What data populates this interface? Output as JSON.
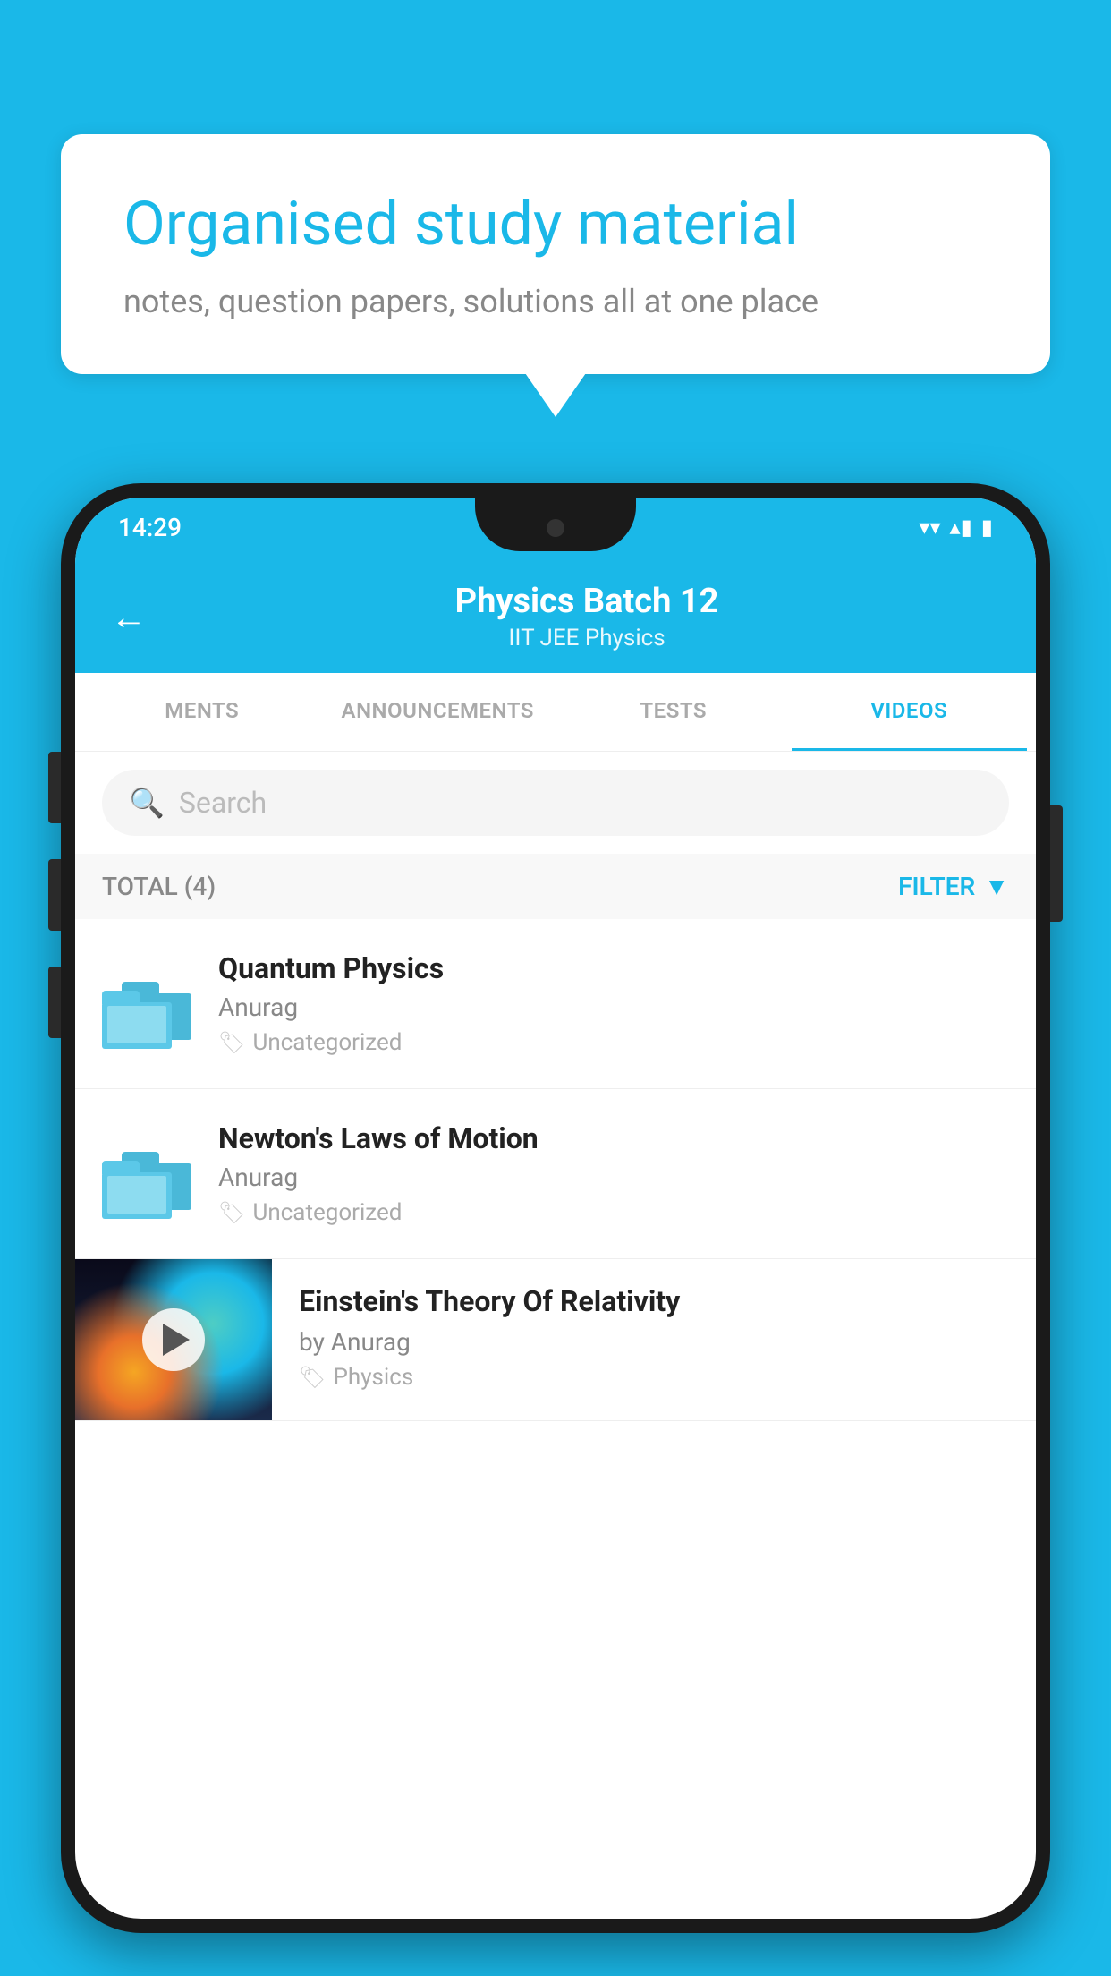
{
  "background": {
    "color": "#1ab8e8"
  },
  "speech_bubble": {
    "title": "Organised study material",
    "subtitle": "notes, question papers, solutions all at one place"
  },
  "status_bar": {
    "time": "14:29",
    "wifi": "▾",
    "signal": "▴",
    "battery": "▮"
  },
  "app_header": {
    "title": "Physics Batch 12",
    "subtitle": "IIT JEE   Physics",
    "back_label": "←"
  },
  "tabs": [
    {
      "label": "MENTS",
      "active": false
    },
    {
      "label": "ANNOUNCEMENTS",
      "active": false
    },
    {
      "label": "TESTS",
      "active": false
    },
    {
      "label": "VIDEOS",
      "active": true
    }
  ],
  "search": {
    "placeholder": "Search"
  },
  "filter_bar": {
    "total_label": "TOTAL (4)",
    "filter_label": "FILTER"
  },
  "videos": [
    {
      "title": "Quantum Physics",
      "author": "Anurag",
      "tag": "Uncategorized",
      "type": "folder"
    },
    {
      "title": "Newton's Laws of Motion",
      "author": "Anurag",
      "tag": "Uncategorized",
      "type": "folder"
    },
    {
      "title": "Einstein's Theory Of Relativity",
      "author": "by Anurag",
      "tag": "Physics",
      "type": "video"
    }
  ]
}
